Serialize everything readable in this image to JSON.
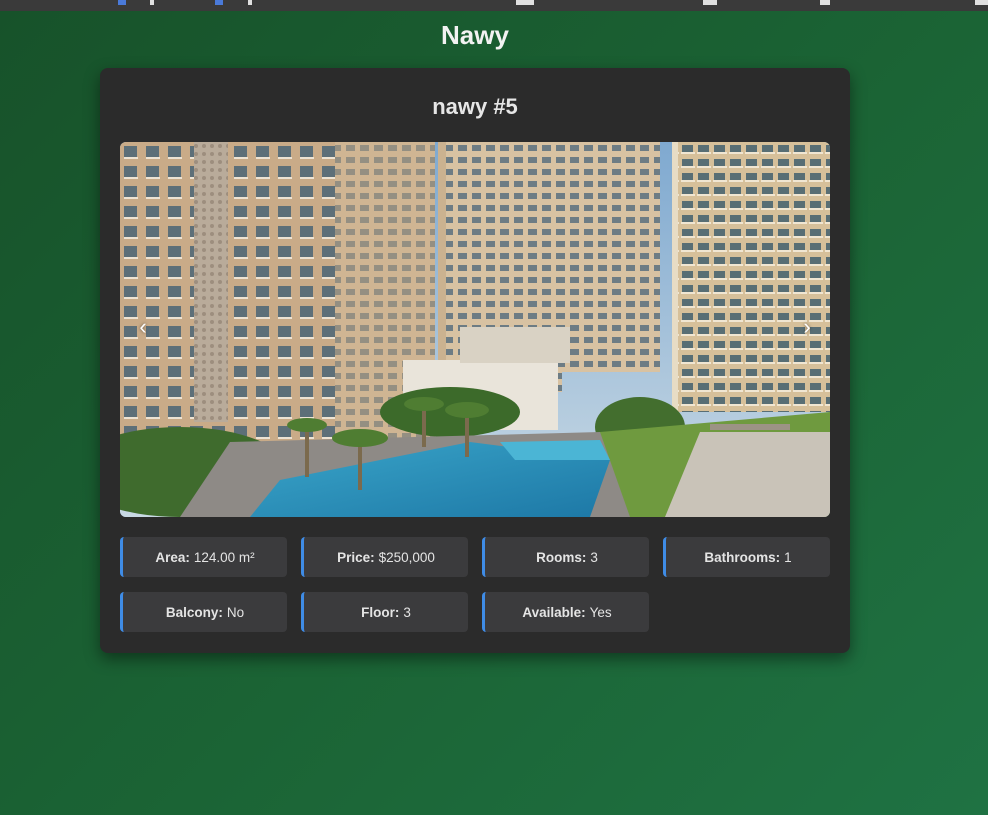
{
  "site": {
    "title": "Nawy"
  },
  "listing": {
    "title": "nawy #5",
    "carousel": {
      "image_alt": "Residential towers with swimming pool",
      "prev_icon": "‹",
      "next_icon": "›"
    },
    "details": [
      {
        "label": "Area:",
        "value": "124.00 m²"
      },
      {
        "label": "Price:",
        "value": "$250,000"
      },
      {
        "label": "Rooms:",
        "value": "3"
      },
      {
        "label": "Bathrooms:",
        "value": "1"
      },
      {
        "label": "Balcony:",
        "value": "No"
      },
      {
        "label": "Floor:",
        "value": "3"
      },
      {
        "label": "Available:",
        "value": "Yes"
      }
    ]
  },
  "colors": {
    "background": "#1b6435",
    "card": "#2b2b2b",
    "detail_bg": "#3b3b3d",
    "accent": "#3f8ce6"
  }
}
